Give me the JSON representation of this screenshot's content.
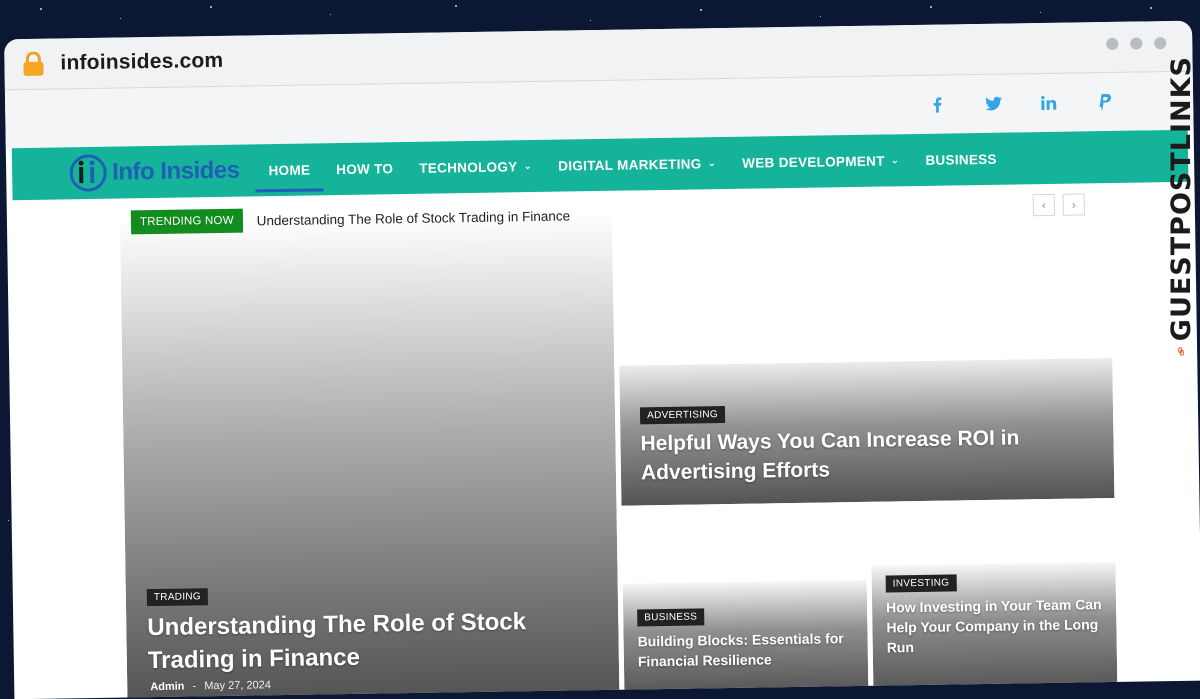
{
  "browser": {
    "url": "infoinsides.com",
    "lock_icon": "lock-icon"
  },
  "social": [
    {
      "icon": "facebook-icon",
      "glyph": "f"
    },
    {
      "icon": "twitter-icon",
      "glyph": "t"
    },
    {
      "icon": "linkedin-icon",
      "glyph": "in"
    },
    {
      "icon": "paypal-icon",
      "glyph": "P"
    }
  ],
  "logo": {
    "text": "Info Insides"
  },
  "nav": {
    "items": [
      {
        "label": "HOME",
        "dropdown": false,
        "active": true
      },
      {
        "label": "HOW TO",
        "dropdown": false
      },
      {
        "label": "TECHNOLOGY",
        "dropdown": true
      },
      {
        "label": "DIGITAL MARKETING",
        "dropdown": true
      },
      {
        "label": "WEB DEVELOPMENT",
        "dropdown": true
      },
      {
        "label": "BUSINESS",
        "dropdown": false
      }
    ]
  },
  "trending": {
    "badge": "TRENDING NOW",
    "headline": "Understanding The Role of Stock Trading in Finance",
    "prev": "‹",
    "next": "›"
  },
  "posts": {
    "main": {
      "category": "TRADING",
      "title": "Understanding The Role of Stock Trading in Finance",
      "author": "Admin",
      "separator": "-",
      "date": "May 27, 2024"
    },
    "top_right": {
      "category": "ADVERTISING",
      "title": "Helpful Ways You Can Increase ROI in Advertising Efforts"
    },
    "bottom_left": {
      "category": "BUSINESS",
      "title": "Building Blocks: Essentials for Financial Resilience"
    },
    "bottom_right": {
      "category": "INVESTING",
      "title": "How Investing in Your Team Can Help Your Company in the Long Run"
    }
  },
  "side_brand": {
    "text": "GUESTPOSTLINKS"
  },
  "colors": {
    "nav": "#14b39a",
    "trending_badge": "#118d1d",
    "social": "#33a4e6",
    "brand_orange": "#f4511e"
  }
}
